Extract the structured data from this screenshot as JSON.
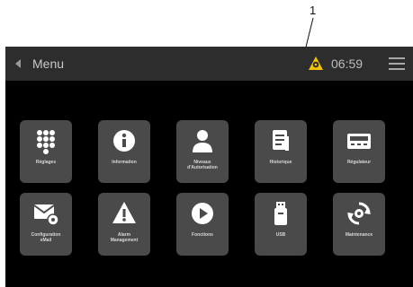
{
  "callout": {
    "number": "1"
  },
  "header": {
    "title": "Menu",
    "time": "06:59"
  },
  "tiles": [
    {
      "label": "Réglages",
      "icon": "keypad-icon"
    },
    {
      "label": "Information",
      "icon": "info-icon"
    },
    {
      "label": "Niveaux\nd'Autorisation",
      "icon": "user-icon"
    },
    {
      "label": "Historique",
      "icon": "document-icon"
    },
    {
      "label": "Régulateur",
      "icon": "controller-icon"
    },
    {
      "label": "Configuration\neMail",
      "icon": "email-settings-icon"
    },
    {
      "label": "Alarm\nManagement",
      "icon": "warning-icon"
    },
    {
      "label": "Fonctions",
      "icon": "play-icon"
    },
    {
      "label": "USB",
      "icon": "usb-icon"
    },
    {
      "label": "Maintenance",
      "icon": "maintenance-icon"
    }
  ],
  "colors": {
    "alarm": "#f2c200",
    "tile": "#4a4a4a",
    "topbar": "#2d2d2d"
  }
}
